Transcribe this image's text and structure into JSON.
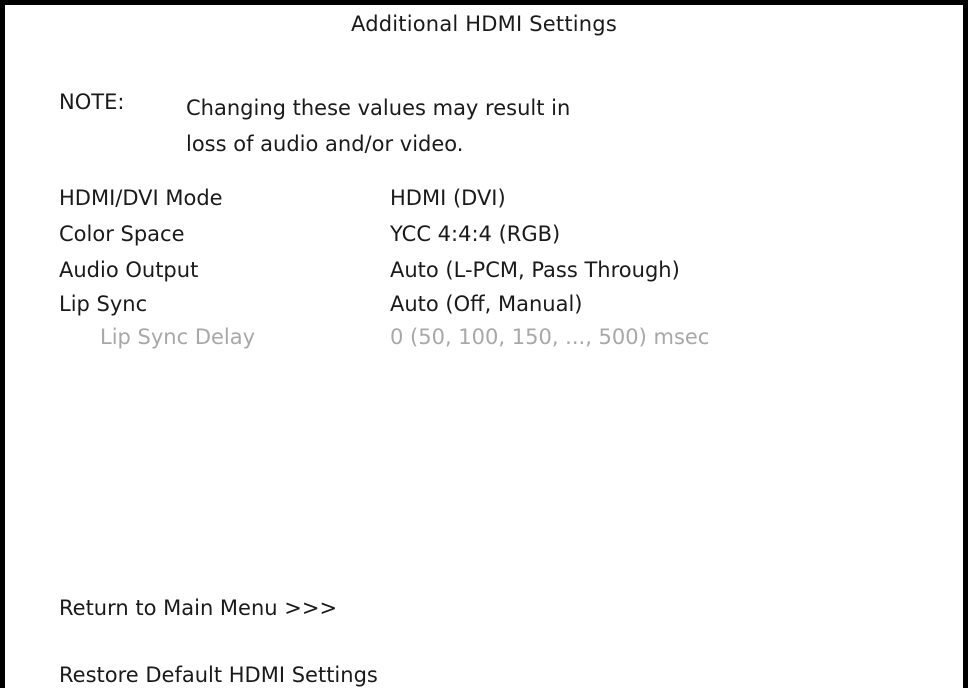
{
  "header": {
    "title": "Additional HDMI Settings"
  },
  "note": {
    "label": "NOTE:",
    "text": "Changing these values may result in\nloss of audio and/or video."
  },
  "settings": [
    {
      "label": "HDMI/DVI Mode",
      "value": "HDMI (DVI)",
      "enabled": true
    },
    {
      "label": "Color Space",
      "value": "YCC 4:4:4 (RGB)",
      "enabled": true
    },
    {
      "label": "Audio Output",
      "value": "Auto (L-PCM, Pass Through)",
      "enabled": true
    },
    {
      "label": "Lip Sync",
      "value": "Auto (Off, Manual)",
      "enabled": true
    },
    {
      "label": "Lip Sync Delay",
      "value": "0 (50, 100, 150, ..., 500) msec",
      "enabled": false
    }
  ],
  "menu": {
    "return_label": "Return to Main Menu >>>",
    "restore_label": "Restore Default HDMI Settings"
  },
  "colors": {
    "text": "#1a1a1a",
    "disabled_text": "#a8a8a8",
    "border": "#000000",
    "background": "#ffffff"
  }
}
